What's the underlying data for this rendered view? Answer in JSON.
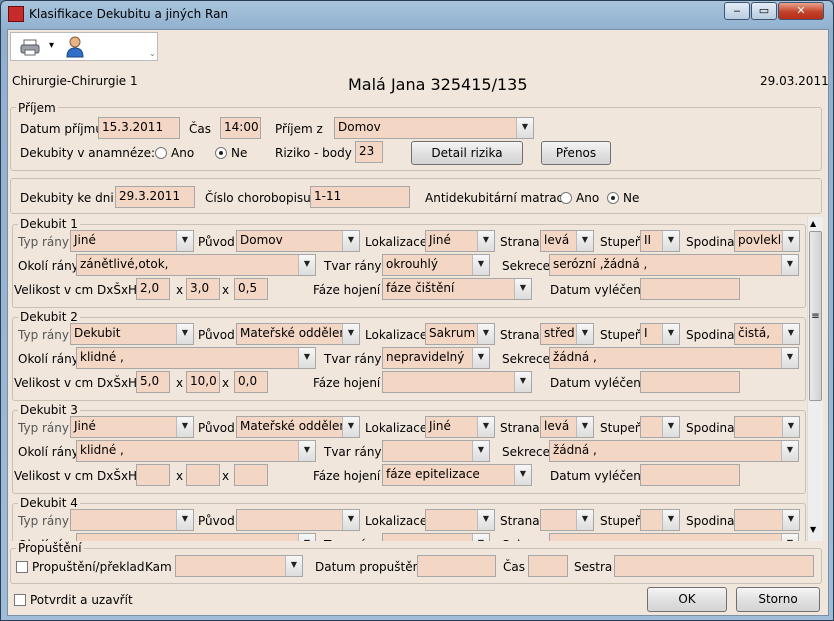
{
  "window": {
    "title": "Klasifikace Dekubitu a jiných Ran",
    "minimize": "‒",
    "maximize": "▭",
    "close": "✕"
  },
  "toolbar": {
    "dropdown_arrow": "▾"
  },
  "header": {
    "department": "Chirurgie-Chirurgie 1",
    "patient": "Malá Jana 325415/135",
    "date": "29.03.2011"
  },
  "prijem": {
    "legend": "Příjem",
    "datum_label": "Datum příjmu",
    "datum": "15.3.2011",
    "cas_label": "Čas",
    "cas": "14:00",
    "prijem_z_label": "Příjem z",
    "prijem_z": "Domov",
    "anamneza_label": "Dekubity v anamnéze:",
    "ano": "Ano",
    "ne": "Ne",
    "riziko_label": "Riziko - body",
    "riziko": "23",
    "detail_btn": "Detail rizika",
    "prenos_btn": "Přenos"
  },
  "dekubity": {
    "ke_dni_label": "Dekubity ke dni",
    "ke_dni": "29.3.2011",
    "chorobopis_label": "Číslo chorobopisu",
    "chorobopis": "1-11",
    "matrace_label": "Antidekubitární matrace",
    "ano": "Ano",
    "ne": "Ne"
  },
  "labels": {
    "typ": "Typ rány",
    "puvod": "Původ",
    "lokalizace": "Lokalizace",
    "strana": "Strana",
    "stupen": "Stupeň",
    "spodina": "Spodina",
    "okoli": "Okolí rány",
    "tvar": "Tvar rány",
    "sekrece": "Sekrece",
    "velikost": "Velikost v cm DxŠxH",
    "x": "x",
    "faze": "Fáze hojení",
    "vyleceni": "Datum vyléčení"
  },
  "wounds": [
    {
      "title": "Dekubit 1",
      "typ": "Jiné",
      "puvod": "Domov",
      "lokalizace": "Jiné",
      "strana": "levá",
      "stupen": "II",
      "spodina": "povlekla",
      "okoli": "zánětlivé,otok,",
      "tvar": "okrouhlý",
      "sekrece": "serózní ,žádná ,",
      "d": "2,0",
      "s": "3,0",
      "h": "0,5",
      "faze": "fáze čištění",
      "vyleceni": ""
    },
    {
      "title": "Dekubit 2",
      "typ": "Dekubit",
      "puvod": "Mateřské oddělení",
      "lokalizace": "Sakrum",
      "strana": "střed",
      "stupen": "I",
      "spodina": "čistá,",
      "okoli": "klidné ,",
      "tvar": "nepravidelný",
      "sekrece": "žádná ,",
      "d": "5,0",
      "s": "10,0",
      "h": "0,0",
      "faze": "",
      "vyleceni": ""
    },
    {
      "title": "Dekubit 3",
      "typ": "Jiné",
      "puvod": "Mateřské oddělení",
      "lokalizace": "Jiné",
      "strana": "levá",
      "stupen": "",
      "spodina": "",
      "okoli": "klidné ,",
      "tvar": "",
      "sekrece": "žádná ,",
      "d": "",
      "s": "",
      "h": "",
      "faze": "fáze epitelizace",
      "vyleceni": ""
    },
    {
      "title": "Dekubit 4",
      "typ": "",
      "puvod": "",
      "lokalizace": "",
      "strana": "",
      "stupen": "",
      "spodina": "",
      "okoli": "",
      "tvar": "",
      "sekrece": "",
      "d": "",
      "s": "",
      "h": "",
      "faze": "",
      "vyleceni": ""
    }
  ],
  "propusteni": {
    "legend": "Propuštění",
    "chk_label": "Propuštění/překlad",
    "kam_label": "Kam",
    "kam": "",
    "datum_label": "Datum propuštění",
    "datum": "",
    "cas_label": "Čas",
    "cas": "",
    "sestra_label": "Sestra",
    "sestra": ""
  },
  "footer": {
    "confirm_label": "Potvrdit a uzavřít",
    "ok": "OK",
    "storno": "Storno"
  },
  "scrollbar": {
    "up": "▲",
    "down": "▼",
    "grip": "≡"
  },
  "icons": {
    "printer": "printer-icon",
    "user": "user-icon"
  }
}
